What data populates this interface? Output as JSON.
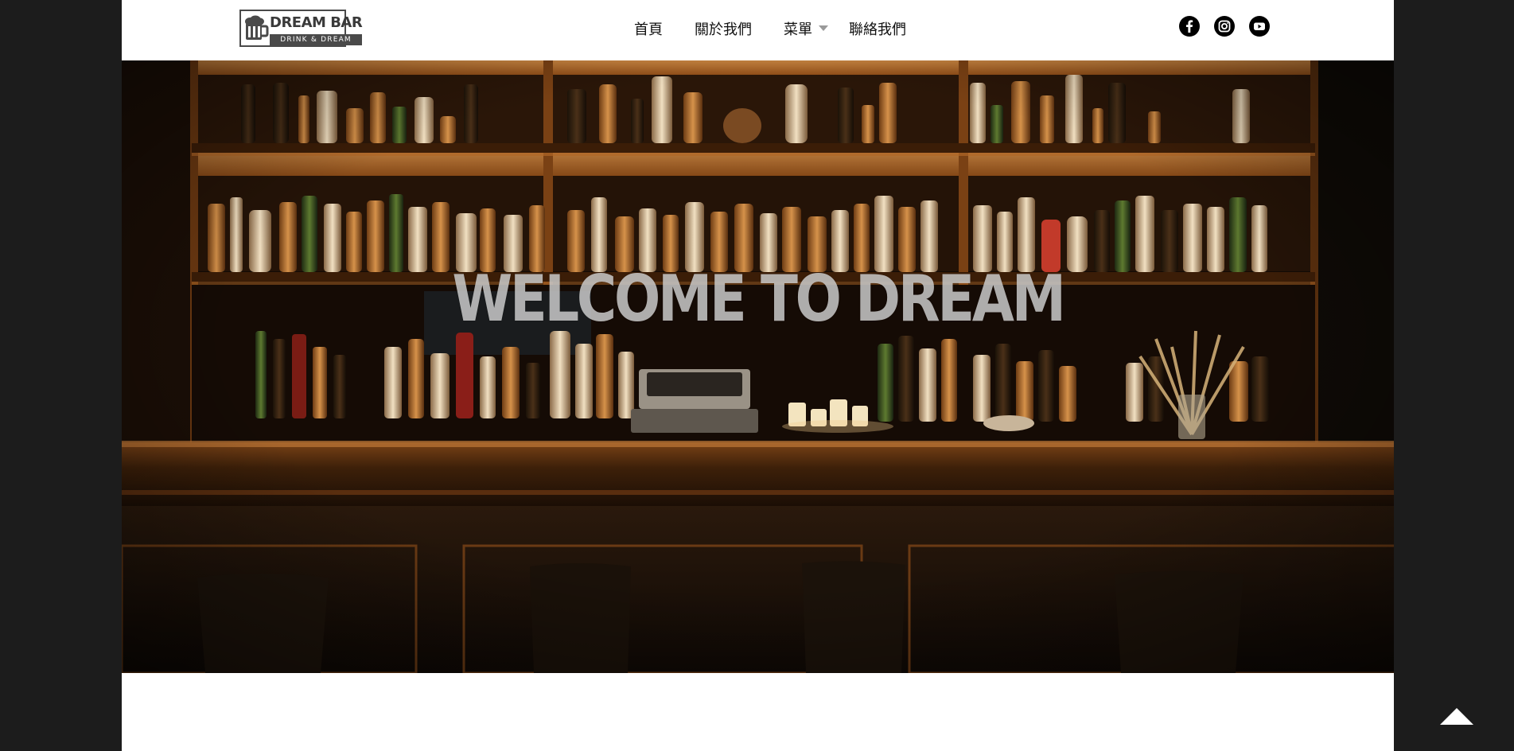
{
  "brand": {
    "title": "DREAM BAR",
    "subtitle": "DRINK & DREAM"
  },
  "nav": {
    "items": [
      {
        "label": "首頁"
      },
      {
        "label": "關於我們"
      },
      {
        "label": "菜單",
        "has_dropdown": true
      },
      {
        "label": "聯絡我們"
      }
    ]
  },
  "socials": [
    {
      "icon": "facebook-icon"
    },
    {
      "icon": "instagram-icon"
    },
    {
      "icon": "youtube-icon"
    }
  ],
  "hero": {
    "title": "WELCOME TO DREAM",
    "image": "bar-interior-photo"
  },
  "colors": {
    "page_background": "#1c1c1c",
    "header_background": "#ffffff",
    "hero_warm": "#c4782f",
    "title_text": "#d2d2d2"
  }
}
